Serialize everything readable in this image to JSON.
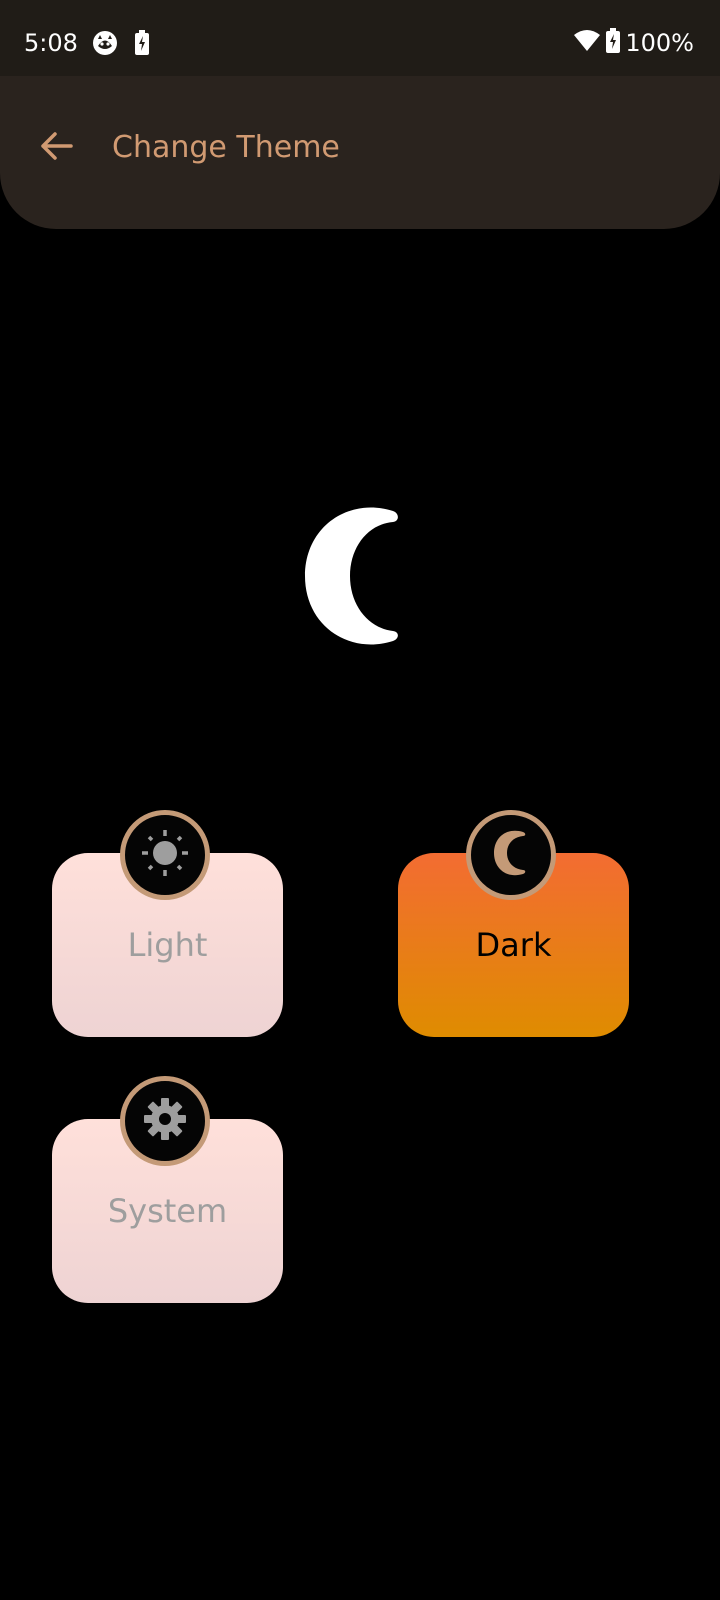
{
  "status_bar": {
    "time": "5:08",
    "battery_text": "100%",
    "icons": [
      "cat-notification-icon",
      "battery-saver-icon",
      "wifi-icon",
      "battery-charging-icon"
    ]
  },
  "app_bar": {
    "title": "Change Theme",
    "back_icon": "arrow-back-icon",
    "accent_color": "#d19a72"
  },
  "preview": {
    "icon": "moon-icon"
  },
  "themes": [
    {
      "label": "Light",
      "icon": "sun-icon",
      "selected": false
    },
    {
      "label": "Dark",
      "icon": "moon-icon",
      "selected": true
    },
    {
      "label": "System",
      "icon": "gear-icon",
      "selected": false
    }
  ],
  "colors": {
    "background": "#000000",
    "status_bar": "#201c17",
    "app_bar": "#2a231e",
    "badge_ring": "#c49a77",
    "selected_gradient_top": "#f36c32",
    "selected_gradient_bottom": "#df8c00",
    "unselected_gradient_top": "#ffe0da",
    "unselected_gradient_bottom": "#eed3d3"
  }
}
